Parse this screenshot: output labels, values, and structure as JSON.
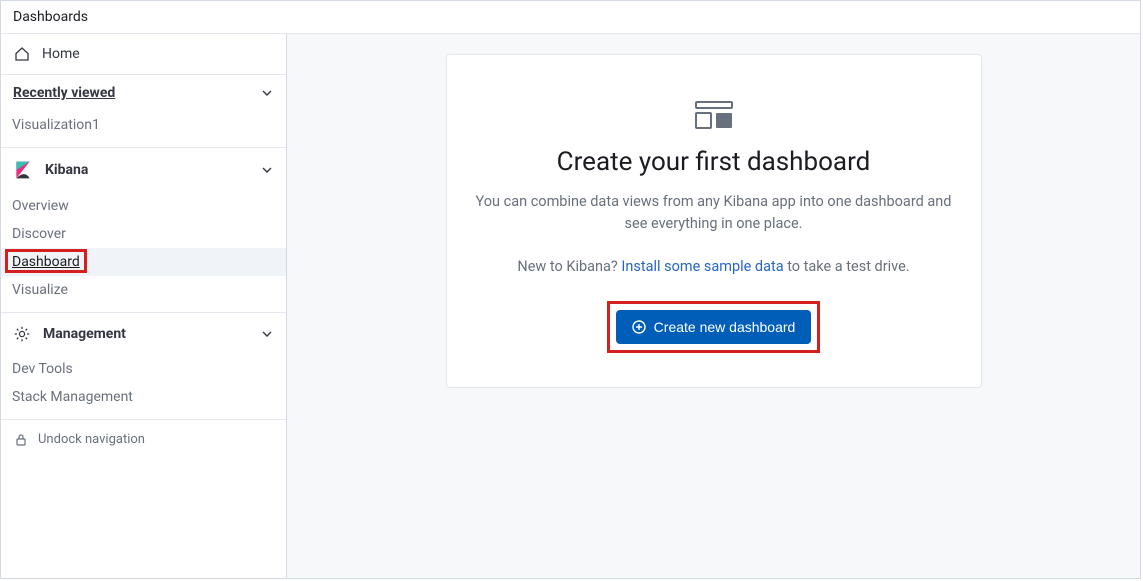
{
  "topbar": {
    "title": "Dashboards"
  },
  "sidebar": {
    "home": "Home",
    "recently_viewed": {
      "label": "Recently viewed",
      "items": [
        "Visualization1"
      ]
    },
    "kibana": {
      "label": "Kibana",
      "items": [
        "Overview",
        "Discover",
        "Dashboard",
        "Visualize"
      ],
      "active_index": 2
    },
    "management": {
      "label": "Management",
      "items": [
        "Dev Tools",
        "Stack Management"
      ]
    },
    "undock": "Undock navigation"
  },
  "main": {
    "heading": "Create your first dashboard",
    "description": "You can combine data views from any Kibana app into one dashboard and see everything in one place.",
    "hint_prefix": "New to Kibana? ",
    "hint_link": "Install some sample data",
    "hint_suffix": " to take a test drive.",
    "button": "Create new dashboard"
  }
}
